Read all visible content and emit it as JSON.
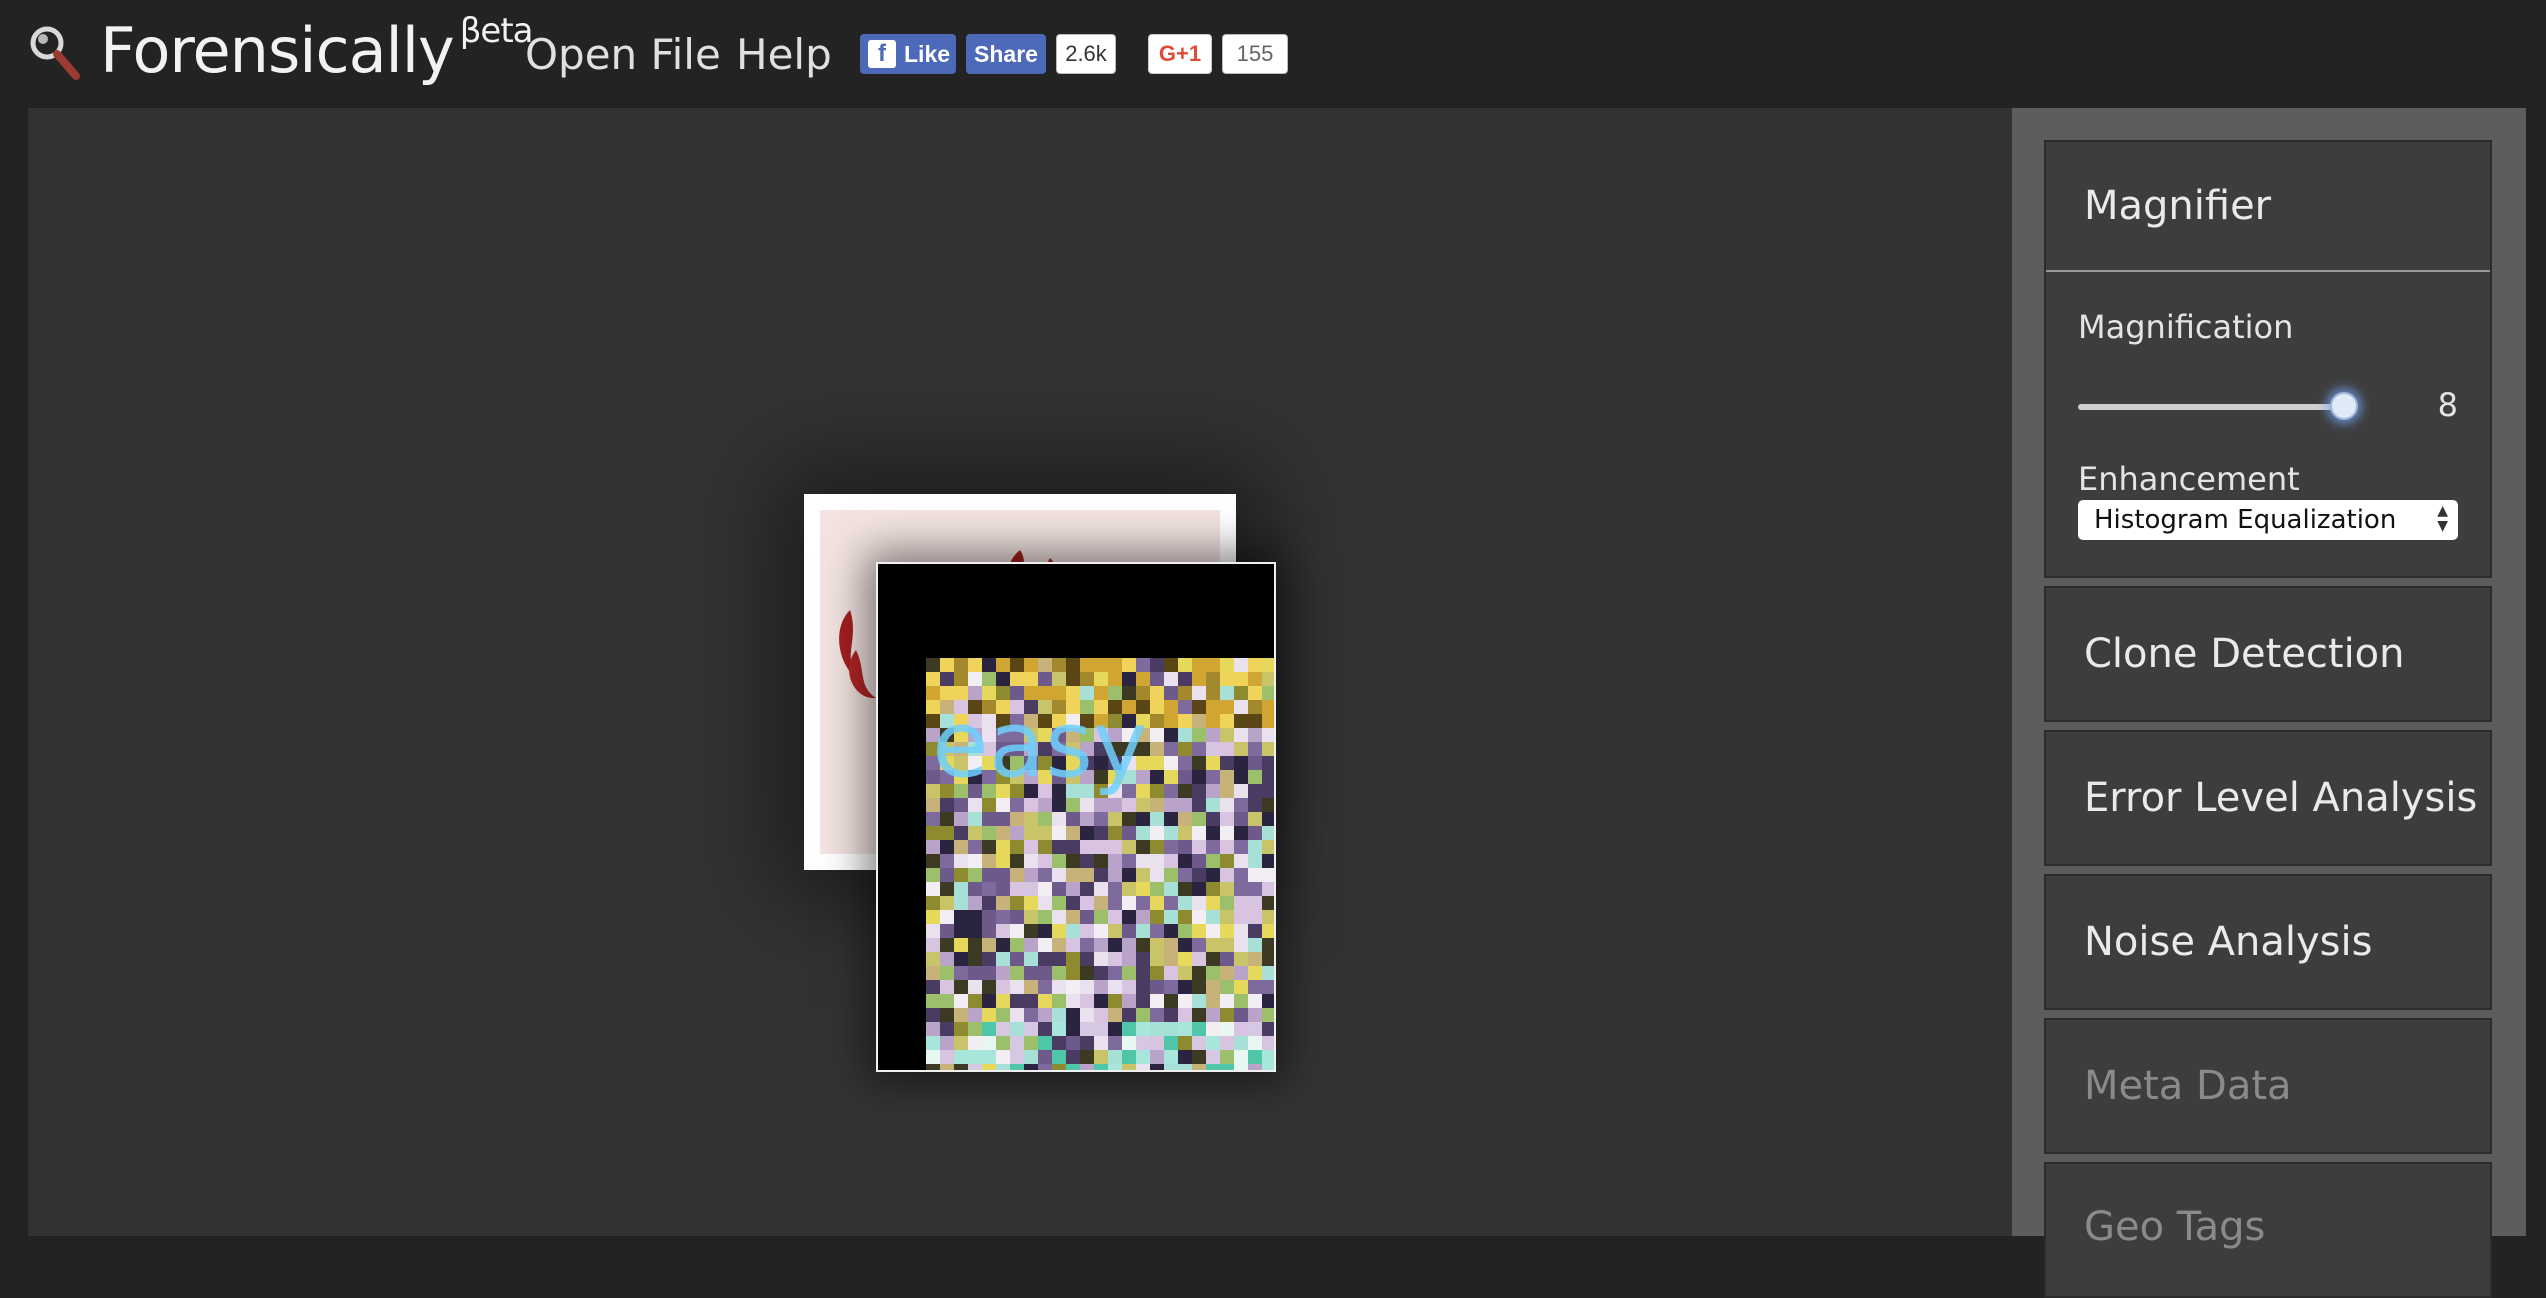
{
  "header": {
    "brand": "Forensically",
    "beta": "βeta",
    "nav": [
      {
        "label": "Open File"
      },
      {
        "label": "Help"
      }
    ],
    "social": {
      "fb_like": "Like",
      "fb_share": "Share",
      "fb_count": "2.6k",
      "gplus": "G+1",
      "gplus_count": "155"
    }
  },
  "sidebar": {
    "magnifier": {
      "title": "Magnifier",
      "magnification_label": "Magnification",
      "magnification_value": "8",
      "enhancement_label": "Enhancement",
      "enhancement_value": "Histogram Equalization"
    },
    "tools": [
      {
        "label": "Clone Detection"
      },
      {
        "label": "Error Level Analysis"
      },
      {
        "label": "Noise Analysis"
      },
      {
        "label": "Meta Data"
      },
      {
        "label": "Geo Tags"
      }
    ]
  },
  "image_text": "easy",
  "colors": {
    "topbar": "#232323",
    "canvas": "#333333",
    "sidebar": "#5d5d5d",
    "panel": "#3d3d3d",
    "facebook": "#4c69ba",
    "gplus": "#dd4b39"
  }
}
